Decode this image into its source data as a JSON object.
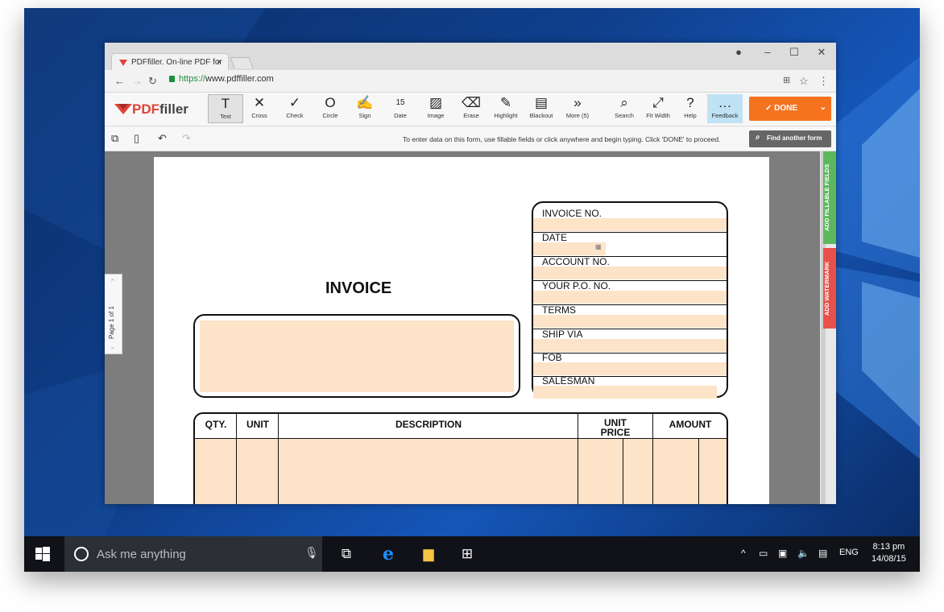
{
  "browser": {
    "tab_title": "PDFfiller. On-line PDF for",
    "tab_close": "×",
    "url_scheme": "https://",
    "url_rest": "www.pdffiller.com"
  },
  "app": {
    "logo_pdf": "PDF",
    "logo_filler": "filler",
    "tools": [
      {
        "label": "Text",
        "icon": "T"
      },
      {
        "label": "Cross",
        "icon": "✕"
      },
      {
        "label": "Check",
        "icon": "✓"
      },
      {
        "label": "Circle",
        "icon": "O"
      },
      {
        "label": "Sign",
        "icon": "✍"
      },
      {
        "label": "Date",
        "icon": "15"
      },
      {
        "label": "Image",
        "icon": "▨"
      },
      {
        "label": "Erase",
        "icon": "⌫"
      },
      {
        "label": "Highlight",
        "icon": "✎"
      },
      {
        "label": "Blackout",
        "icon": "▤"
      },
      {
        "label": "More (5)",
        "icon": "»"
      },
      {
        "label": "Search",
        "icon": "⌕"
      },
      {
        "label": "Fit Width",
        "icon": "⤢"
      },
      {
        "label": "Help",
        "icon": "?"
      },
      {
        "label": "Feedback",
        "icon": "…"
      }
    ],
    "done_label": "DONE",
    "hint": "To enter data on this form, use fillable fields or click anywhere and begin typing. Click 'DONE' to proceed.",
    "find_label": "Find another form",
    "page_indicator": "Page 1 of 1",
    "add_fillable_fields": "ADD FILLABLE FIELDS",
    "add_watermark": "ADD WATERMARK"
  },
  "invoice": {
    "title": "INVOICE",
    "fields": [
      "INVOICE NO.",
      "DATE",
      "ACCOUNT NO.",
      "YOUR P.O. NO.",
      "TERMS",
      "SHIP VIA",
      "FOB",
      "SALESMAN"
    ],
    "columns": [
      "QTY.",
      "UNIT",
      "DESCRIPTION",
      "UNIT PRICE",
      "AMOUNT"
    ]
  },
  "taskbar": {
    "search_placeholder": "Ask me anything",
    "language": "ENG",
    "time": "8:13 pm",
    "date": "14/08/15"
  },
  "colors": {
    "accent_orange": "#f5731f",
    "field_fill": "#fde3c7",
    "fillable_green": "#5cb85c",
    "watermark_red": "#e8504a"
  }
}
